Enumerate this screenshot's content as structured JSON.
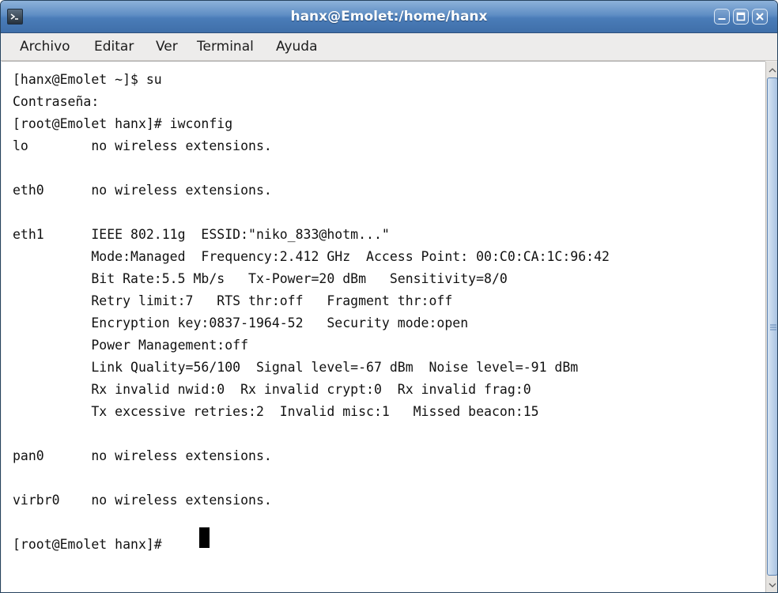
{
  "window": {
    "title": "hanx@Emolet:/home/hanx",
    "accent": "#4a7cb8",
    "icons": {
      "app": "terminal-icon",
      "minimize": "minimize-icon",
      "maximize": "maximize-icon",
      "close": "close-icon"
    }
  },
  "menu": [
    {
      "label": "Archivo"
    },
    {
      "label": "Editar"
    },
    {
      "label": "Ver"
    },
    {
      "label": "Terminal"
    },
    {
      "label": "Ayuda"
    }
  ],
  "terminal": {
    "lines": [
      "[hanx@Emolet ~]$ su",
      "Contraseña:",
      "[root@Emolet hanx]# iwconfig",
      "lo        no wireless extensions.",
      "",
      "eth0      no wireless extensions.",
      "",
      "eth1      IEEE 802.11g  ESSID:\"niko_833@hotm...\"",
      "          Mode:Managed  Frequency:2.412 GHz  Access Point: 00:C0:CA:1C:96:42",
      "          Bit Rate:5.5 Mb/s   Tx-Power=20 dBm   Sensitivity=8/0",
      "          Retry limit:7   RTS thr:off   Fragment thr:off",
      "          Encryption key:0837-1964-52   Security mode:open",
      "          Power Management:off",
      "          Link Quality=56/100  Signal level=-67 dBm  Noise level=-91 dBm",
      "          Rx invalid nwid:0  Rx invalid crypt:0  Rx invalid frag:0",
      "          Tx excessive retries:2  Invalid misc:1   Missed beacon:15",
      "",
      "pan0      no wireless extensions.",
      "",
      "virbr0    no wireless extensions.",
      "",
      "[root@Emolet hanx]# "
    ]
  },
  "scrollbar": {
    "icons": {
      "up": "scroll-up-arrow-icon",
      "down": "scroll-down-arrow-icon",
      "grip": "scroll-grip-icon"
    }
  }
}
